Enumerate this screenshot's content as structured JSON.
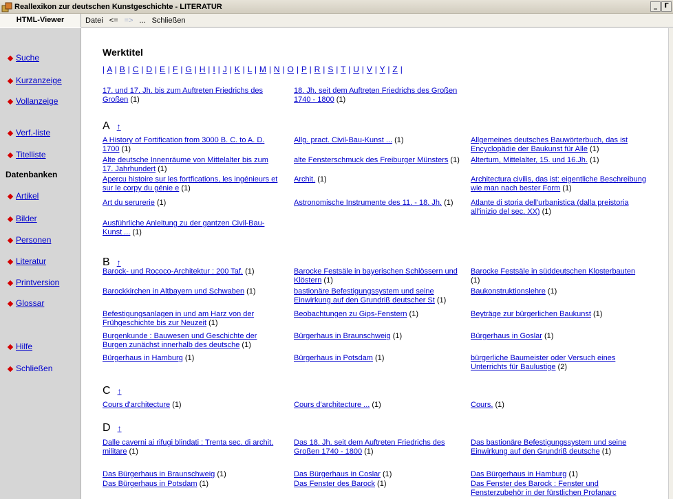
{
  "window": {
    "title": "Reallexikon zur deutschen Kunstgeschichte - LITERATUR",
    "minimize_glyph": "_",
    "restore_glyph": "Г"
  },
  "menu": {
    "viewer_tab": "HTML-Viewer",
    "file": "Datei",
    "back": "<=",
    "forward": "=>",
    "more": "...",
    "close": "Schließen"
  },
  "sidebar": {
    "items": [
      {
        "label": "Suche",
        "link": true
      },
      {
        "label": "Kurzanzeige",
        "link": true
      },
      {
        "label": "Vollanzeige",
        "link": true
      },
      {
        "label": "Verf.-liste",
        "link": true
      },
      {
        "label": "Titelliste",
        "link": true
      },
      {
        "label": "Artikel",
        "link": true
      },
      {
        "label": "Bilder",
        "link": true
      },
      {
        "label": "Personen",
        "link": true
      },
      {
        "label": "Literatur",
        "link": true
      },
      {
        "label": "Printversion",
        "link": true
      },
      {
        "label": "Glossar",
        "link": true
      },
      {
        "label": "Hilfe",
        "link": true
      },
      {
        "label": "Schließen",
        "link": false
      }
    ],
    "header": "Datenbanken"
  },
  "content": {
    "title": "Werktitel",
    "alphabet": [
      "A",
      "B",
      "C",
      "D",
      "E",
      "F",
      "G",
      "H",
      "I",
      "J",
      "K",
      "L",
      "M",
      "N",
      "O",
      "P",
      "R",
      "S",
      "T",
      "U",
      "V",
      "Y",
      "Z"
    ],
    "up_arrow": "↑",
    "top_entries": [
      {
        "title": "17. und 17. Jh. bis zum Auftreten Friedrichs des Großen",
        "count": "(1)"
      },
      {
        "title": "18. Jh. seit dem Auftreten Friedrichs des Großen 1740 - 1800",
        "count": "(1)"
      }
    ],
    "sections": [
      {
        "letter": "A",
        "entries": [
          {
            "title": "A History of Fortification from 3000 B. C. to A. D. 1700",
            "count": "(1)"
          },
          {
            "title": "Allg. pract. Civil-Bau-Kunst ...",
            "count": "(1)"
          },
          {
            "title": "Allgemeines deutsches Bauwörterbuch, das ist Encyclopädie der Baukunst für Alle",
            "count": "(1)"
          },
          {
            "title": "Alte deutsche Innenräume von Mittelalter bis zum 17. Jahrhundert",
            "count": "(1)"
          },
          {
            "title": "alte Fensterschmuck des Freiburger Münsters",
            "count": "(1)"
          },
          {
            "title": "Altertum, Mittelalter, 15. und 16.Jh.",
            "count": "(1)"
          },
          {
            "title": "Apercu histoire sur les fortfications, les ingénieurs et sur le corpy du génie e",
            "count": "(1)"
          },
          {
            "title": "Archit.",
            "count": "(1)"
          },
          {
            "title": "Architectura civilis, das ist: eigentliche Beschreibung wie man nach bester Form",
            "count": "(1)"
          },
          {
            "title": "Art du serurerie",
            "count": "(1)"
          },
          {
            "title": "Astronomische Instrumente des 11. - 18. Jh.",
            "count": "(1)"
          },
          {
            "title": "Atlante di storia dell'urbanistica (dalla preistoria all'inizio del sec. XX)",
            "count": "(1)"
          },
          {
            "title": "Ausführliche Anleitung zu der gantzen Civil-Bau-Kunst ...",
            "count": "(1)"
          }
        ]
      },
      {
        "letter": "B",
        "entries": [
          {
            "title": "Barock- und Rococo-Architektur : 200 Taf.",
            "count": "(1)"
          },
          {
            "title": "Barocke Festsäle in bayerischen Schlössern und Klöstern",
            "count": "(1)"
          },
          {
            "title": "Barocke Festsäle in süddeutschen Klosterbauten",
            "count": "(1)"
          },
          {
            "title": "Barockkirchen in Altbayern und Schwaben",
            "count": "(1)"
          },
          {
            "title": "bastionäre Befestigungssystem und seine Einwirkung auf den Grundriß deutscher St",
            "count": "(1)"
          },
          {
            "title": "Baukonstruktionslehre",
            "count": "(1)"
          },
          {
            "title": "Befestigungsanlagen in und am Harz von der Frühgeschichte bis zur Neuzeit",
            "count": "(1)"
          },
          {
            "title": "Beobachtungen zu Gips-Fenstern",
            "count": "(1)"
          },
          {
            "title": "Beyträge zur bürgerlichen Baukunst",
            "count": "(1)"
          },
          {
            "title": "Burgenkunde : Bauwesen und Geschichte der Burgen zunächst innerhalb des deutsche",
            "count": "(1)"
          },
          {
            "title": "Bürgerhaus in Braunschweig",
            "count": "(1)"
          },
          {
            "title": "Bürgerhaus in Goslar",
            "count": "(1)"
          },
          {
            "title": "Bürgerhaus in Hamburg",
            "count": "(1)"
          },
          {
            "title": "Bürgerhaus in Potsdam",
            "count": "(1)"
          },
          {
            "title": "bürgerliche Baumeister oder Versuch eines Unterrichts für Baulustige",
            "count": "(2)"
          }
        ]
      },
      {
        "letter": "C",
        "entries": [
          {
            "title": "Cours d'architecture",
            "count": "(1)"
          },
          {
            "title": "Cours d'architecture ...",
            "count": "(1)"
          },
          {
            "title": "Cours.",
            "count": "(1)"
          }
        ]
      },
      {
        "letter": "D",
        "entries": [
          {
            "title": "Dalle caverni ai rifugi blindati : Trenta sec. di archit. militare",
            "count": "(1)"
          },
          {
            "title": "Das 18. Jh. seit dem Auftreten Friedrichs des Großen 1740 - 1800",
            "count": "(1)"
          },
          {
            "title": "Das bastionäre Befestigungssystem und seine Einwirkung auf den Grundriß deutsche",
            "count": "(1)"
          },
          {
            "title": "Das Bürgerhaus in Braunschweig",
            "count": "(1)"
          },
          {
            "title": "Das Bürgerhaus in Coslar",
            "count": "(1)"
          },
          {
            "title": "Das Bürgerhaus in Hamburg",
            "count": "(1)"
          },
          {
            "title": "Das Bürgerhaus in Potsdam",
            "count": "(1)"
          },
          {
            "title": "Das Fenster des Barock",
            "count": "(1)"
          },
          {
            "title": "Das Fenster des Barock : Fenster und Fensterzubehör in der fürstlichen Profanarc",
            "count": ""
          }
        ]
      }
    ]
  }
}
